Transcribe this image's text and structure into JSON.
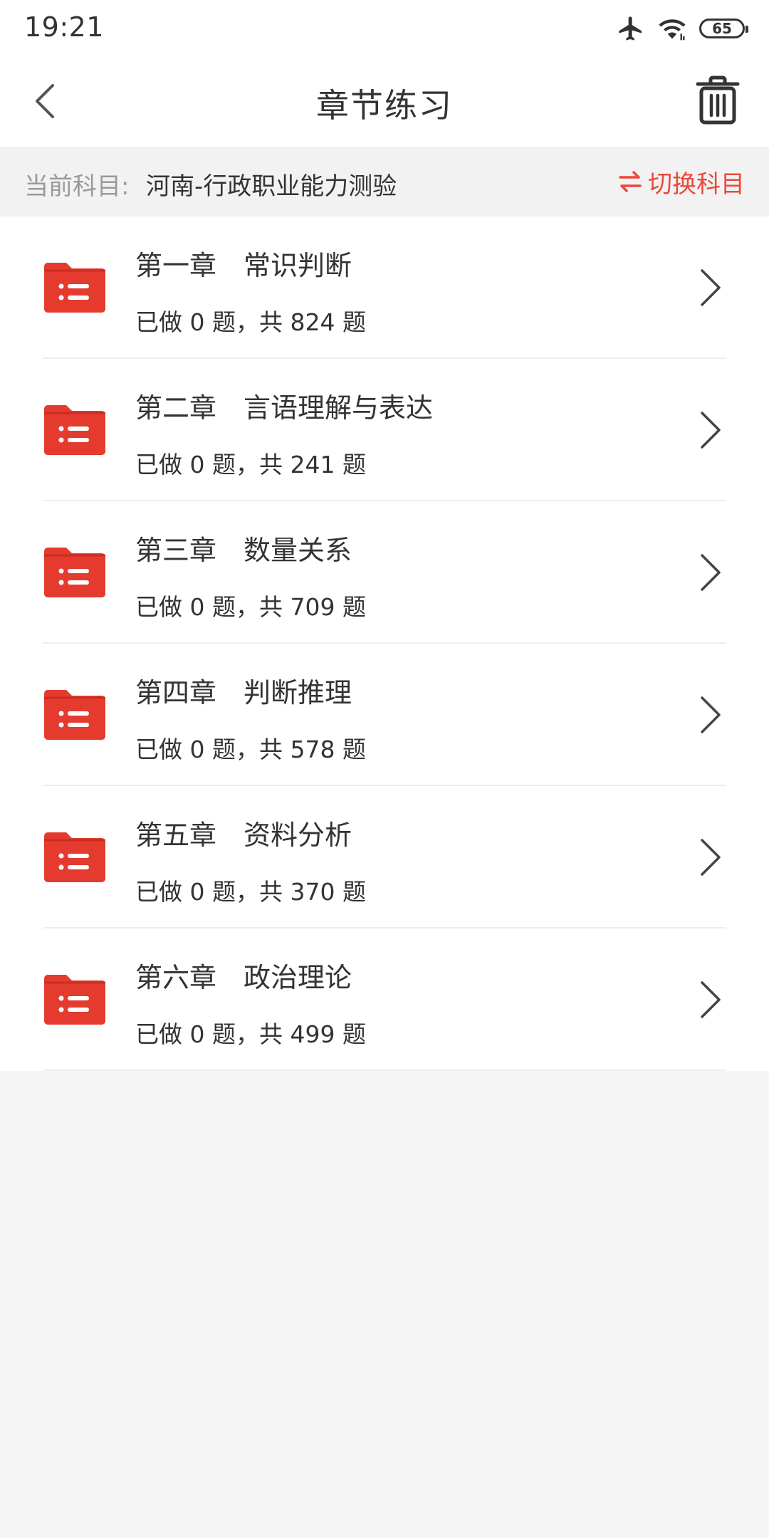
{
  "status_bar": {
    "time": "19:21",
    "battery": "65",
    "icons": [
      "airplane-icon",
      "wifi-icon",
      "battery-icon"
    ]
  },
  "header": {
    "title": "章节练习",
    "back_icon": "chevron-left-icon",
    "delete_icon": "trash-icon"
  },
  "subject": {
    "label": "当前科目:",
    "value": "河南-行政职业能力测验",
    "switch_label": "切换科目",
    "switch_icon": "swap-icon"
  },
  "chapters": [
    {
      "title": "第一章　常识判断",
      "progress": "已做 0 题，共 824 题"
    },
    {
      "title": "第二章　言语理解与表达",
      "progress": "已做 0 题，共 241 题"
    },
    {
      "title": "第三章　数量关系",
      "progress": "已做 0 题，共 709 题"
    },
    {
      "title": "第四章　判断推理",
      "progress": "已做 0 题，共 578 题"
    },
    {
      "title": "第五章　资料分析",
      "progress": "已做 0 题，共 370 题"
    },
    {
      "title": "第六章　政治理论",
      "progress": "已做 0 题，共 499 题"
    }
  ],
  "colors": {
    "accent": "#e84a3c",
    "folder": "#e53b2f",
    "background": "#f5f5f5"
  }
}
